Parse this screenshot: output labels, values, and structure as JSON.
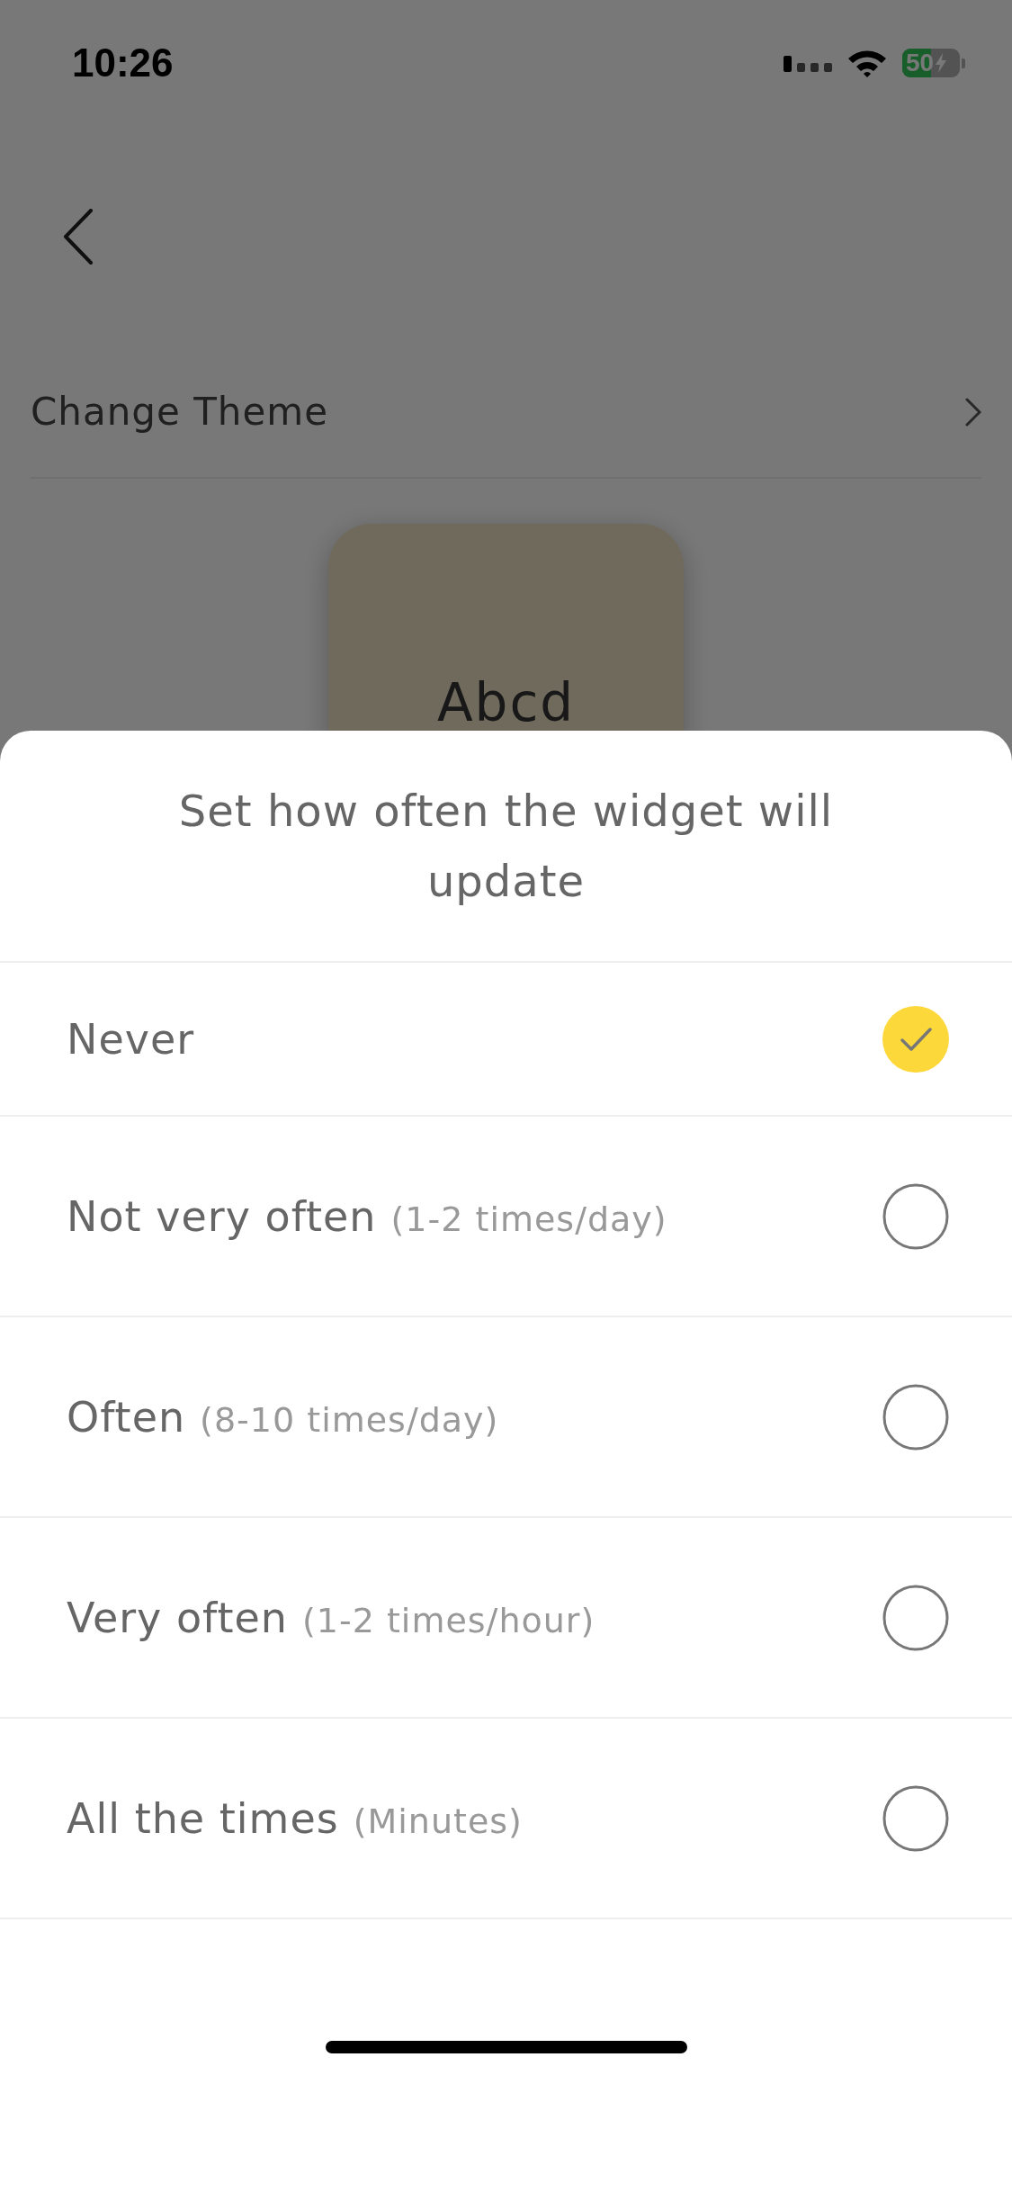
{
  "status_bar": {
    "time": "10:26",
    "battery": "50",
    "charging": true
  },
  "settings": [
    {
      "label": "Change Theme"
    }
  ],
  "widget_preview": {
    "text": "Abcd"
  },
  "sheet": {
    "title": "Set how often the widget will update",
    "options": [
      {
        "label": "Never",
        "selected": true
      },
      {
        "label": "Not very often",
        "hint": "(1-2 times/day)",
        "selected": false
      },
      {
        "label": "Often",
        "hint": "(8-10 times/day)",
        "selected": false
      },
      {
        "label": "Very often",
        "hint": "(1-2 times/hour)",
        "selected": false
      },
      {
        "label": "All the times",
        "hint": "(Minutes)",
        "selected": false
      }
    ]
  }
}
